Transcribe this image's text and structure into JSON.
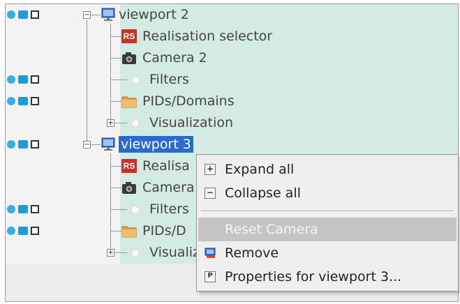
{
  "tree": {
    "rows": [
      {
        "label": "viewport 2",
        "type": "viewport",
        "expander": "−"
      },
      {
        "label": "Realisation selector",
        "type": "rs",
        "badge": "RS"
      },
      {
        "label": "Camera 2",
        "type": "camera"
      },
      {
        "label": "Filters",
        "type": "dot"
      },
      {
        "label": "PIDs/Domains",
        "type": "folder"
      },
      {
        "label": "Visualization",
        "type": "dot",
        "expander": "+"
      },
      {
        "label": "viewport 3",
        "type": "viewport",
        "expander": "−",
        "selected": true
      },
      {
        "label": "Realisa",
        "type": "rs",
        "badge": "RS"
      },
      {
        "label": "Camera",
        "type": "camera"
      },
      {
        "label": "Filters",
        "type": "dot"
      },
      {
        "label": "PIDs/D",
        "type": "folder"
      },
      {
        "label": "Visualiz",
        "type": "dot",
        "expander": "+"
      }
    ]
  },
  "context_menu": {
    "items": [
      {
        "label": "Expand all",
        "icon": "expand-icon",
        "glyph": "+"
      },
      {
        "label": "Collapse all",
        "icon": "collapse-icon",
        "glyph": "−"
      },
      {
        "label": "Reset Camera",
        "icon": "none",
        "disabled": true
      },
      {
        "label": "Remove",
        "icon": "remove-icon"
      },
      {
        "label": "Properties for viewport 3...",
        "icon": "properties-icon",
        "glyph": "P"
      }
    ]
  },
  "colors": {
    "row_bg": "#d4ebe4",
    "selection": "#2a6acb",
    "toggle_blue": "#1f9bd6",
    "rs_red": "#c8312b"
  }
}
